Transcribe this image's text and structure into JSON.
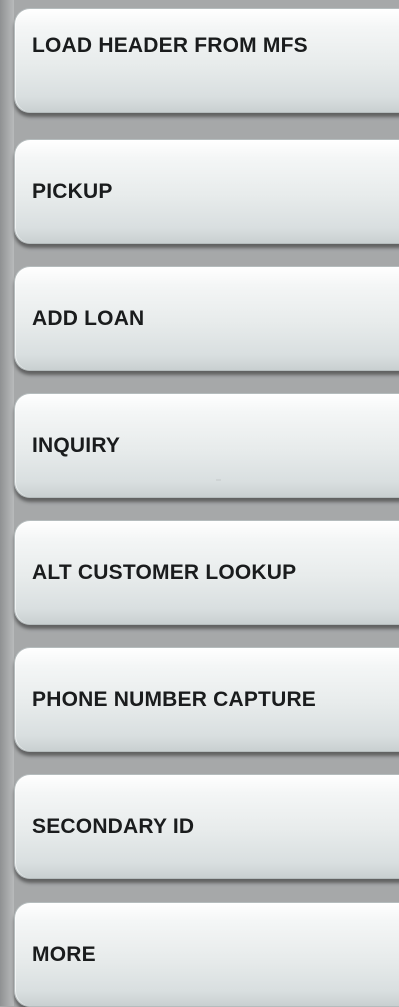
{
  "menu": {
    "items": [
      {
        "label": "LOAD HEADER FROM MFS"
      },
      {
        "label": "PICKUP"
      },
      {
        "label": "ADD LOAN"
      },
      {
        "label": "INQUIRY"
      },
      {
        "label": "ALT CUSTOMER LOOKUP"
      },
      {
        "label": "PHONE NUMBER CAPTURE"
      },
      {
        "label": "SECONDARY ID"
      },
      {
        "label": "MORE"
      }
    ]
  },
  "colors": {
    "background": "#a6a8a9",
    "button_top": "#ffffff",
    "button_bottom": "#c9d0d1",
    "label_text": "#1a1c1d"
  }
}
